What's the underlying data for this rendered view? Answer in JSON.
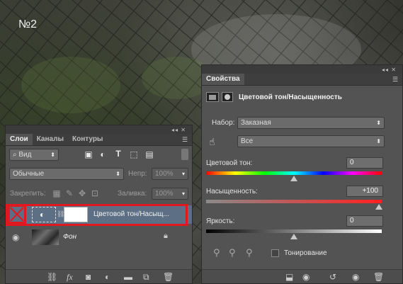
{
  "canvas": {
    "label": "№2"
  },
  "layers_panel": {
    "tabs": [
      {
        "label": "Слои"
      },
      {
        "label": "Каналы"
      },
      {
        "label": "Контуры"
      }
    ],
    "filter": {
      "kind": "Вид"
    },
    "blend_mode": {
      "value": "Обычные"
    },
    "opacity": {
      "label": "Непр:",
      "value": "100%"
    },
    "lock": {
      "label": "Закрепить:"
    },
    "fill": {
      "label": "Заливка:",
      "value": "100%"
    },
    "layers": [
      {
        "name": "Цветовой тон/Насыщ..."
      },
      {
        "name": "Фон"
      }
    ],
    "icons": {
      "filter_pixel": "image-filter-icon",
      "filter_adjust": "adjustment-filter-icon",
      "filter_type": "type-filter-icon",
      "filter_shape": "shape-filter-icon",
      "filter_smart": "smart-object-filter-icon",
      "lock_pixels": "checkerboard-lock-icon",
      "lock_paint": "brush-lock-icon",
      "lock_move": "move-lock-icon",
      "lock_all": "padlock-icon"
    }
  },
  "properties_panel": {
    "tab": "Свойства",
    "title": "Цветовой тон/Насыщенность",
    "preset": {
      "label": "Набор:",
      "value": "Заказная"
    },
    "channel": {
      "value": "Все"
    },
    "hue": {
      "label": "Цветовой тон:",
      "value": "0"
    },
    "saturation": {
      "label": "Насыщенность:",
      "value": "+100"
    },
    "lightness": {
      "label": "Яркость:",
      "value": "0"
    },
    "colorize": {
      "label": "Тонирование"
    },
    "slider_levels": {
      "hue": 0.5,
      "saturation": 1.0,
      "lightness": 0.5
    }
  },
  "colors": {
    "panel_bg": "#535353",
    "selected_layer": "#5d6f85",
    "highlight": "#e0181f"
  }
}
